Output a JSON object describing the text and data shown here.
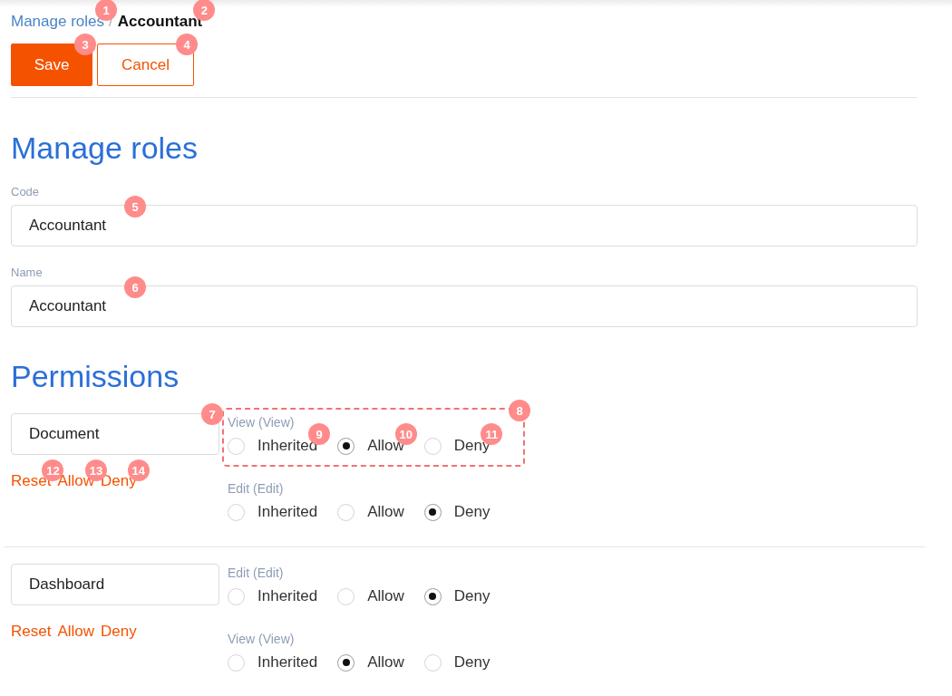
{
  "breadcrumb": [
    {
      "label": "Manage roles",
      "kind": "link",
      "marker": "1"
    },
    {
      "label": "/",
      "kind": "separator"
    },
    {
      "label": "Accountant",
      "kind": "current",
      "marker": "2"
    }
  ],
  "toolbar": [
    {
      "label": "Save",
      "kind": "primary",
      "marker": "3"
    },
    {
      "label": "Cancel",
      "kind": "secondary",
      "marker": "4"
    }
  ],
  "title": "Manage roles",
  "fields": [
    {
      "label": "Code",
      "value": "Accountant",
      "marker": "5"
    },
    {
      "label": "Name",
      "value": "Accountant",
      "marker": "6"
    }
  ],
  "permissions": {
    "title": "Permissions",
    "groups": [
      {
        "resource": "Document",
        "marker": "7",
        "actions": [
          {
            "label": "Reset",
            "marker": "12"
          },
          {
            "label": "Allow",
            "marker": "13"
          },
          {
            "label": "Deny",
            "marker": "14"
          }
        ],
        "rules": [
          {
            "label": "View (View)",
            "highlighted": true,
            "marker": "8",
            "options": [
              {
                "label": "Inherited",
                "selected": false,
                "marker": "9"
              },
              {
                "label": "Allow",
                "selected": true,
                "marker": "10"
              },
              {
                "label": "Deny",
                "selected": false,
                "marker": "11"
              }
            ]
          },
          {
            "label": "Edit (Edit)",
            "highlighted": false,
            "options": [
              {
                "label": "Inherited",
                "selected": false
              },
              {
                "label": "Allow",
                "selected": false
              },
              {
                "label": "Deny",
                "selected": true
              }
            ]
          }
        ]
      },
      {
        "resource": "Dashboard",
        "actions": [
          {
            "label": "Reset"
          },
          {
            "label": "Allow"
          },
          {
            "label": "Deny"
          }
        ],
        "rules": [
          {
            "label": "Edit (Edit)",
            "highlighted": false,
            "options": [
              {
                "label": "Inherited",
                "selected": false
              },
              {
                "label": "Allow",
                "selected": false
              },
              {
                "label": "Deny",
                "selected": true
              }
            ]
          },
          {
            "label": "View (View)",
            "highlighted": false,
            "options": [
              {
                "label": "Inherited",
                "selected": false
              },
              {
                "label": "Allow",
                "selected": true
              },
              {
                "label": "Deny",
                "selected": false
              }
            ]
          }
        ]
      }
    ]
  }
}
